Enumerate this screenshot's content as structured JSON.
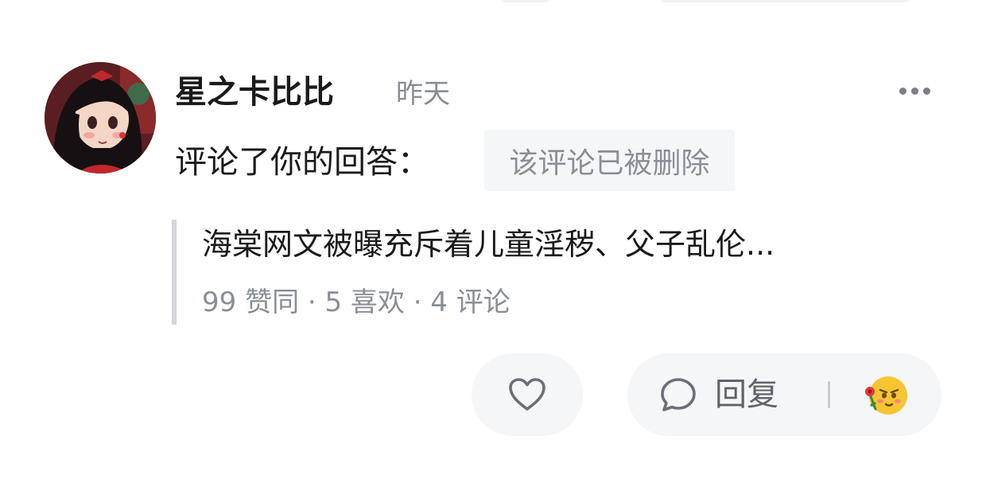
{
  "comment": {
    "username": "星之卡比比",
    "timestamp": "昨天",
    "action_text": "评论了你的回答：",
    "deleted_notice": "该评论已被删除"
  },
  "quoted_answer": {
    "title": "海棠网文被曝充斥着儿童淫秽、父子乱伦...",
    "stats": "99 赞同 · 5 喜欢 · 4 评论"
  },
  "actions": {
    "reply_label": "回复"
  },
  "icons": {
    "more": "more-horizontal-icon",
    "like": "heart-icon",
    "reply": "comment-bubble-icon",
    "emoji": "flower-emoji-icon"
  },
  "colors": {
    "primary_text": "#1a1a1a",
    "secondary_text": "#8a8e96",
    "pill_background": "#f5f6f8",
    "quote_bar": "#d4d6da"
  }
}
